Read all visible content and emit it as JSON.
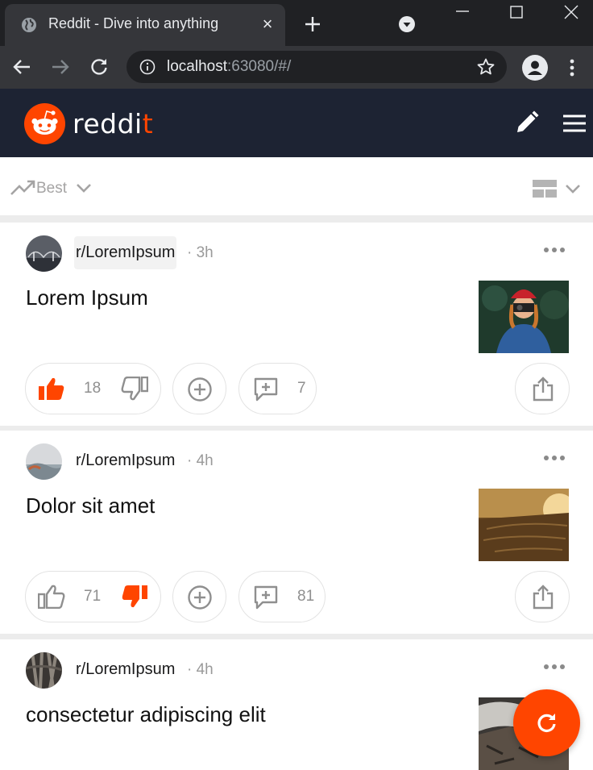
{
  "browser": {
    "tab_title": "Reddit - Dive into anything",
    "tab_close": "×",
    "url_host": "localhost",
    "url_rest": ":63080/#/"
  },
  "app": {
    "wordmark_main": "reddi",
    "wordmark_end": "t",
    "brand_color": "#ff4500",
    "header_color": "#1d2333"
  },
  "sortbar": {
    "label": "Best"
  },
  "posts": [
    {
      "subreddit": "r/LoremIpsum",
      "age": "· 3h",
      "title": "Lorem Ipsum",
      "vote_count": "18",
      "comment_count": "7",
      "vote_state": "up",
      "thumbnail": "woman-with-camera"
    },
    {
      "subreddit": "r/LoremIpsum",
      "age": "· 4h",
      "title": "Dolor sit amet",
      "vote_count": "71",
      "comment_count": "81",
      "vote_state": "down",
      "thumbnail": "tree-stump-sunset"
    },
    {
      "subreddit": "r/LoremIpsum",
      "age": "· 4h",
      "title": "consectetur adipiscing elit",
      "vote_state": "none",
      "thumbnail": "rocky-waterfall"
    }
  ]
}
